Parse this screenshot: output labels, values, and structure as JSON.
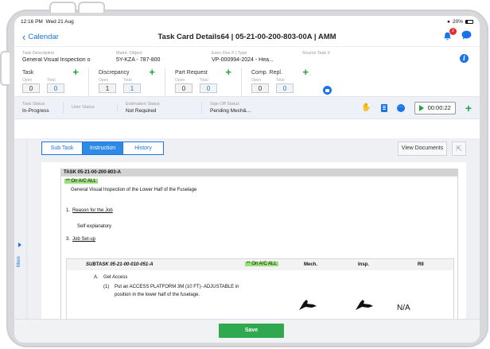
{
  "status_bar": {
    "time": "12:16 PM",
    "date": "Wed 21 Aug",
    "battery": "20%"
  },
  "nav": {
    "back_label": "Calendar",
    "title": "Task Card Details64 | 05-21-00-200-803-00A | AMM",
    "notification_count": "2"
  },
  "details": {
    "task_description_label": "Task Description",
    "task_description": "General Visual Inspection o",
    "maint_object_label": "Maint. Object",
    "maint_object": "5Y-KZA - 787-800",
    "exec_doc_label": "Exec.Doc # | Type",
    "exec_doc": "VP-000994-2024 - Hea...",
    "source_task_label": "Source Task #",
    "source_task": ""
  },
  "counters": [
    {
      "title": "Task",
      "open_label": "Open",
      "total_label": "Total",
      "open": "0",
      "total": "0"
    },
    {
      "title": "Discrepancy",
      "open_label": "Open",
      "total_label": "Total",
      "open": "1",
      "total": "1"
    },
    {
      "title": "Part Request",
      "open_label": "Open",
      "total_label": "Total",
      "open": "0",
      "total": "0"
    },
    {
      "title": "Comp. Repl.",
      "open_label": "Open",
      "total_label": "Total",
      "open": "0",
      "total": "0"
    }
  ],
  "status_row": {
    "task_status_label": "Task Status",
    "task_status": "In-Progress",
    "user_status_label": "User Status",
    "user_status": "",
    "estimation_label": "Estimation Status",
    "estimation": "Not Required",
    "signoff_label": "Sign Off Status",
    "signoff": "Pending Mech&...",
    "timer": "00:00:22"
  },
  "sidebar": {
    "more_label": "More"
  },
  "tabs": {
    "sub_task": "Sub Task",
    "instruction": "Instruction",
    "history": "History"
  },
  "view_documents": "View Documents",
  "document": {
    "task_header": "TASK 05-21-00-200-803-A",
    "applicability": "** On A/C ALL",
    "task_title": "General Visual Inspection of the Lower Half of the Fuselage",
    "step1_num": "1.",
    "step1_title": "Reason for the Job",
    "step1_text": "Self explanatory",
    "step3_num": "3.",
    "step3_title": "Job Set-up",
    "subtask_header": "SUBTASK 05-21-00-010-051-A",
    "subtask_applicability": "** On A/C ALL",
    "col_mech": "Mech.",
    "col_insp": "Insp.",
    "col_rii": "RII",
    "sub_a_letter": "A.",
    "sub_a_title": "Get Access",
    "sub_a1_num": "(1)",
    "sub_a1_line1": "Put an ACCESS PLATFORM 3M (10 FT)- ADJUSTABLE in",
    "sub_a1_line2": "position in the lower half of the fuselage.",
    "rii_value": "N/A"
  },
  "save_label": "Save",
  "colors": {
    "accent": "#1a73e8",
    "add_green": "#22a33a",
    "save_green": "#2fa84f",
    "highlight": "#9ae07a",
    "badge_red": "#e52b2b"
  }
}
